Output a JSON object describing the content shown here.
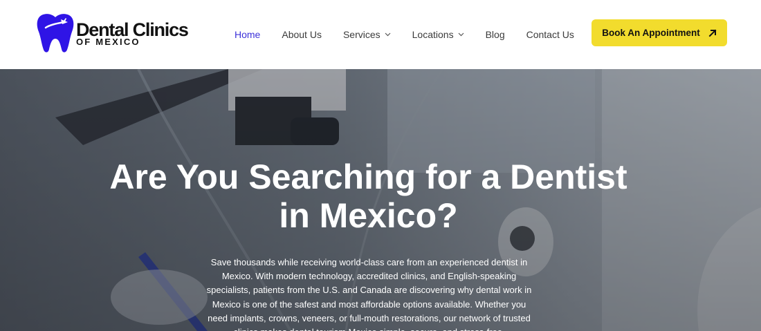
{
  "brand": {
    "line1": "Dental Clinics",
    "line2": "OF MEXICO",
    "logo_color": "#2f14e6"
  },
  "nav": {
    "items": [
      {
        "label": "Home",
        "active": true
      },
      {
        "label": "About Us"
      },
      {
        "label": "Services",
        "icon": "chevron-down-icon"
      },
      {
        "label": "Locations",
        "icon": "chevron-down-icon"
      },
      {
        "label": "Blog"
      },
      {
        "label": "Contact Us"
      }
    ],
    "active_color": "#3b30d9"
  },
  "cta": {
    "label": "Book An Appointment",
    "icon": "arrow-up-right-icon",
    "color": "#f2dc2d"
  },
  "hero": {
    "title": "Are You Searching for a Dentist in Mexico?",
    "text": "Save thousands while receiving world-class care from an experienced dentist in Mexico. With modern technology, accredited clinics, and English-speaking specialists, patients from the U.S. and Canada are discovering why dental work in Mexico is one of the safest and most affordable options available. Whether you need implants, crowns, veneers, or full-mouth restorations, our network of trusted clinics makes dental tourism Mexico simple, secure, and stress-free."
  }
}
